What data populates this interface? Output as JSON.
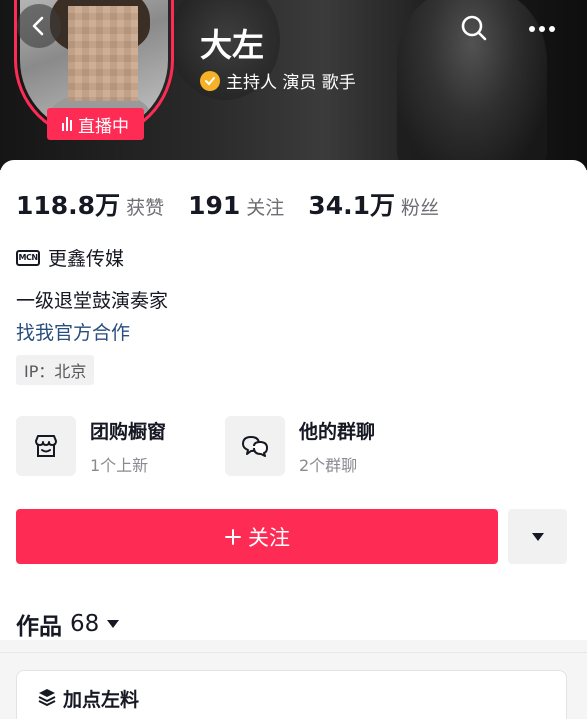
{
  "profile": {
    "name": "大左",
    "tags": "主持人 演员 歌手",
    "live_label": "直播中"
  },
  "stats": [
    {
      "value": "118.8万",
      "label": "获赞"
    },
    {
      "value": "191",
      "label": "关注"
    },
    {
      "value": "34.1万",
      "label": "粉丝"
    }
  ],
  "info": {
    "mcn_badge": "MCN",
    "mcn_name": "更鑫传媒",
    "bio": "一级退堂鼓演奏家",
    "cooperation_link": "找我官方合作",
    "ip_location": "IP：北京"
  },
  "features": [
    {
      "title": "团购橱窗",
      "subtitle": "1个上新",
      "icon": "shop-icon"
    },
    {
      "title": "他的群聊",
      "subtitle": "2个群聊",
      "icon": "chat-icon"
    }
  ],
  "actions": {
    "follow_label": "关注"
  },
  "works": {
    "label": "作品",
    "count": "68"
  },
  "collection": {
    "title": "加点左料"
  },
  "colors": {
    "accent": "#fe2c55",
    "verify": "#f5b227",
    "link": "#2a4e7f"
  }
}
